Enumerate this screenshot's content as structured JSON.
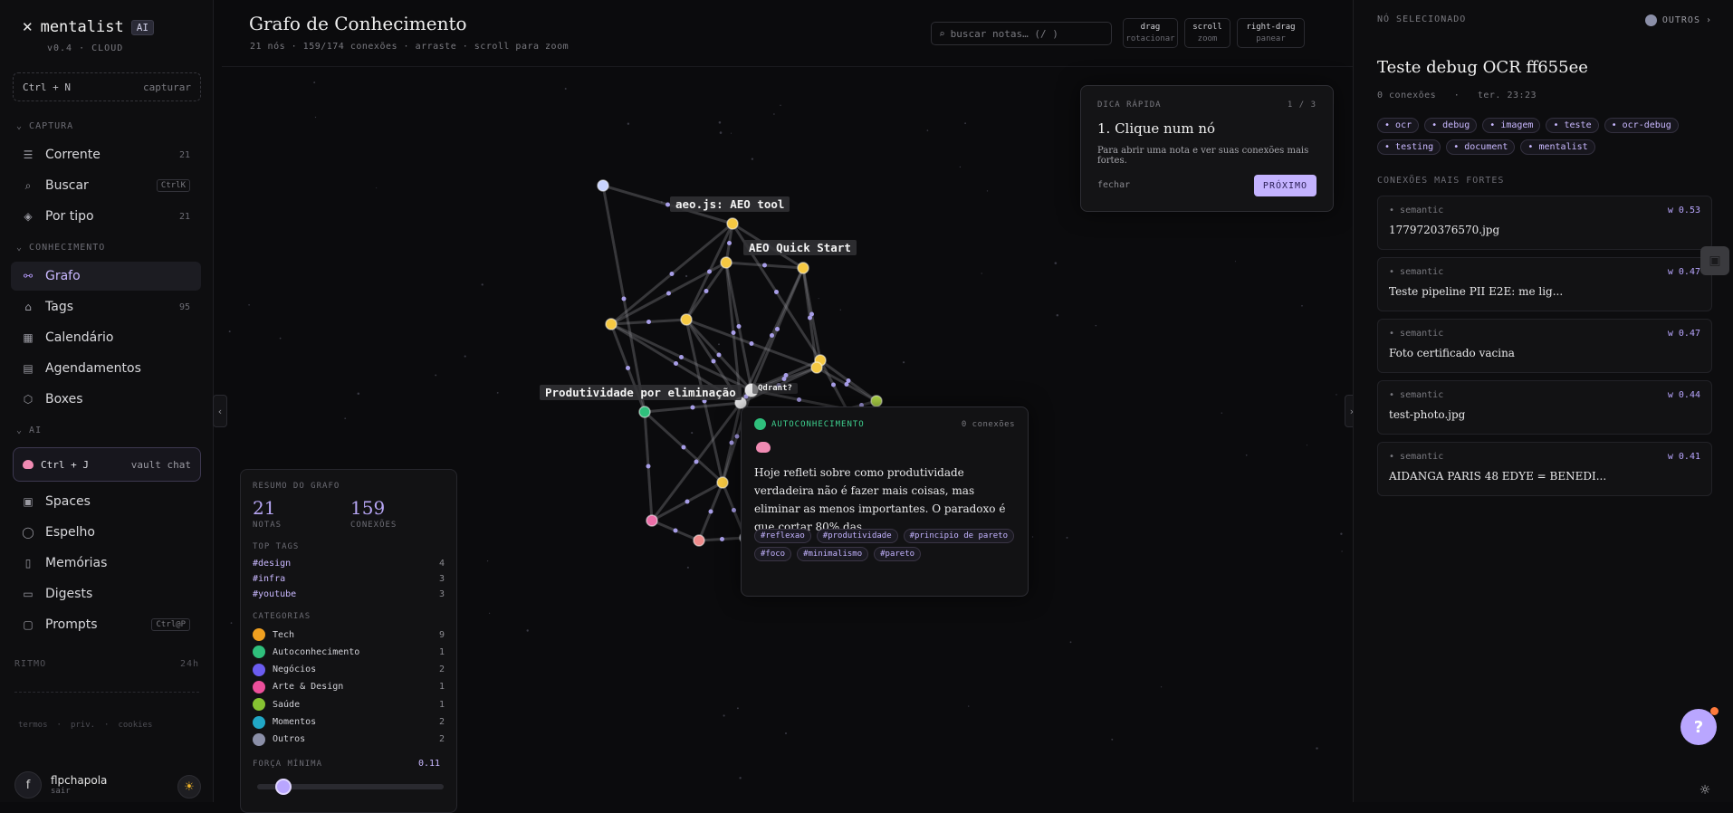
{
  "sidebar": {
    "brand": "mentalist",
    "brand_badge": "AI",
    "version": "v0.4 · CLOUD",
    "capture_shortcut": "Ctrl + N",
    "capture_label": "capturar",
    "section_capture": "CAPTURA",
    "items_capture": [
      {
        "label": "Corrente",
        "count": "21",
        "icon": "list-icon"
      },
      {
        "label": "Buscar",
        "kbd": "CtrlK",
        "icon": "search-icon"
      },
      {
        "label": "Por tipo",
        "count": "21",
        "icon": "layers-icon"
      }
    ],
    "section_knowledge": "CONHECIMENTO",
    "items_knowledge": [
      {
        "label": "Grafo",
        "icon": "graph-icon"
      },
      {
        "label": "Tags",
        "count": "95",
        "icon": "tag-icon"
      },
      {
        "label": "Calendário",
        "icon": "calendar-icon"
      },
      {
        "label": "Agendamentos",
        "icon": "schedule-icon"
      },
      {
        "label": "Boxes",
        "icon": "box-icon"
      }
    ],
    "section_ai": "AI",
    "vault_shortcut": "Ctrl + J",
    "vault_label": "vault chat",
    "items_ai": [
      {
        "label": "Spaces",
        "icon": "grid-icon"
      },
      {
        "label": "Espelho",
        "icon": "bulb-icon"
      },
      {
        "label": "Memórias",
        "icon": "bookmark-icon"
      },
      {
        "label": "Digests",
        "icon": "doc-icon"
      },
      {
        "label": "Prompts",
        "kbd": "Ctrl@P",
        "icon": "prompt-icon"
      }
    ],
    "ritmo_label": "RITMO",
    "ritmo_range": "24h",
    "legal": [
      "termos",
      "·",
      "priv.",
      "·",
      "cookies"
    ],
    "user_initial": "f",
    "user_name": "flpchapola",
    "user_action": "sair"
  },
  "header": {
    "title": "Grafo de Conhecimento",
    "subtitle": "21 nós · 159/174 conexões · arraste · scroll para zoom",
    "search_placeholder": "buscar notas… (/ )",
    "hints": [
      {
        "key": "drag",
        "action": "rotacionar"
      },
      {
        "key": "scroll",
        "action": "zoom"
      },
      {
        "key": "right-drag",
        "action": "panear"
      }
    ]
  },
  "tip": {
    "label": "DICA RÁPIDA",
    "step": "1 / 3",
    "title": "1. Clique num nó",
    "body": "Para abrir uma nota e ver suas conexões mais fortes.",
    "close": "fechar",
    "next": "PRÓXIMO"
  },
  "graph_labels": {
    "aeo_tool": "aeo.js: AEO tool",
    "aeo_quick": "AEO Quick Start",
    "produtividade": "Produtividade por eliminação",
    "qdrant": "Qdrant?"
  },
  "summary": {
    "title": "RESUMO DO GRAFO",
    "notes_value": "21",
    "notes_label": "NOTAS",
    "conn_value": "159",
    "conn_label": "CONEXÕES",
    "top_tags_label": "TOP TAGS",
    "top_tags": [
      {
        "name": "#design",
        "count": "4"
      },
      {
        "name": "#infra",
        "count": "3"
      },
      {
        "name": "#youtube",
        "count": "3"
      }
    ],
    "categories_label": "CATEGORIAS",
    "categories": [
      {
        "name": "Tech",
        "count": "9",
        "color": "#f0a020"
      },
      {
        "name": "Autoconhecimento",
        "count": "1",
        "color": "#2fbf7c"
      },
      {
        "name": "Negócios",
        "count": "2",
        "color": "#6b5cf0"
      },
      {
        "name": "Arte & Design",
        "count": "1",
        "color": "#ec4f9b"
      },
      {
        "name": "Saúde",
        "count": "1",
        "color": "#86c232"
      },
      {
        "name": "Momentos",
        "count": "2",
        "color": "#21a7c6"
      },
      {
        "name": "Outros",
        "count": "2",
        "color": "#8b8fa8"
      }
    ],
    "min_strength_label": "FORÇA MÍNIMA",
    "min_strength_value": "0.11",
    "min_strength_fraction": 0.11
  },
  "popup": {
    "category": "AUTOCONHECIMENTO",
    "connections": "0 conexões",
    "text": "Hoje refleti sobre como produtividade verdadeira não é fazer mais coisas, mas eliminar as menos importantes. O paradoxo é que cortar 80% das",
    "tags": [
      "#reflexao",
      "#produtividade",
      "#principio de pareto",
      "#foco",
      "#minimalismo",
      "#pareto"
    ]
  },
  "right_panel": {
    "header": "NÓ SELECIONADO",
    "category": "OUTROS",
    "title": "Teste debug OCR ff655ee",
    "connections": "0 conexões",
    "sep": "·",
    "date": "ter. 23:23",
    "tags": [
      "ocr",
      "debug",
      "imagem",
      "teste",
      "ocr-debug",
      "testing",
      "document",
      "mentalist"
    ],
    "strongest_label": "CONEXÕES MAIS FORTES",
    "strongest": [
      {
        "type": "semantic",
        "weight": "w 0.53",
        "title": "1779720376570.jpg"
      },
      {
        "type": "semantic",
        "weight": "w 0.47",
        "title": "Teste pipeline PII E2E: me lig..."
      },
      {
        "type": "semantic",
        "weight": "w 0.47",
        "title": "Foto certificado vacina"
      },
      {
        "type": "semantic",
        "weight": "w 0.44",
        "title": "test-photo.jpg"
      },
      {
        "type": "semantic",
        "weight": "w 0.41",
        "title": "AIDANGA PARIS 48 EDYE = BENEDI..."
      }
    ],
    "help": "?"
  },
  "colors": {
    "accent": "#b9a6ff",
    "tech": "#f0a020",
    "autoconhecimento": "#2fbf7c"
  }
}
